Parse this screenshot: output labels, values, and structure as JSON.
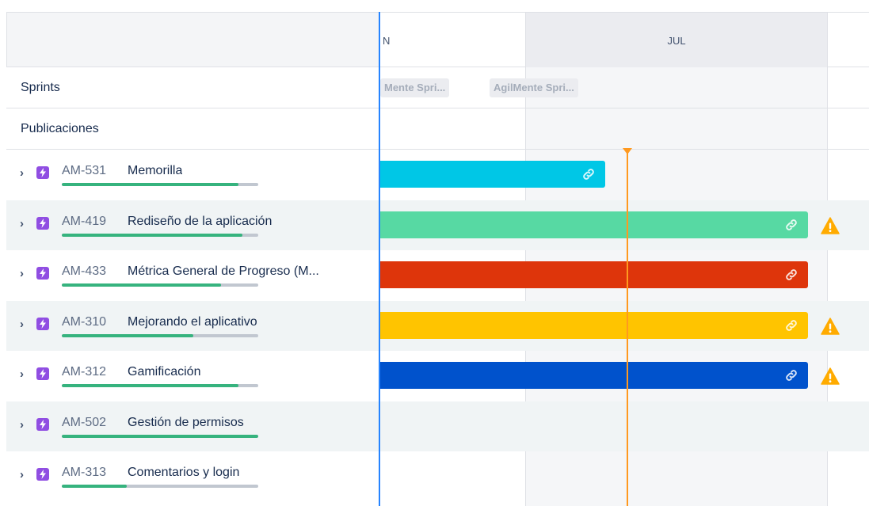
{
  "timeline": {
    "months": {
      "previous_partial": "N",
      "current": "JUL"
    },
    "sprints": [
      "Mente Spri...",
      "AgilMente Spri..."
    ]
  },
  "sections": {
    "sprints": "Sprints",
    "releases": "Publicaciones"
  },
  "issues": [
    {
      "key": "AM-531",
      "title": "Memorilla",
      "progress": 0.9,
      "bar_color": "#00c7e6",
      "bar_end_frac": 0.46,
      "warning": false
    },
    {
      "key": "AM-419",
      "title": "Rediseño de la aplicación",
      "progress": 0.92,
      "bar_color": "#57d9a3",
      "bar_end_frac": 0.875,
      "warning": true
    },
    {
      "key": "AM-433",
      "title": "Métrica General de Progreso (M...",
      "progress": 0.81,
      "bar_color": "#de350b",
      "bar_end_frac": 0.875,
      "warning": false
    },
    {
      "key": "AM-310",
      "title": "Mejorando el aplicativo",
      "progress": 0.67,
      "bar_color": "#ffc400",
      "bar_end_frac": 0.875,
      "warning": true
    },
    {
      "key": "AM-312",
      "title": "Gamificación",
      "progress": 0.9,
      "bar_color": "#0052cc",
      "bar_end_frac": 0.875,
      "warning": true
    },
    {
      "key": "AM-502",
      "title": "Gestión de permisos",
      "progress": 1.0,
      "bar_color": null,
      "bar_end_frac": 0,
      "warning": false
    },
    {
      "key": "AM-313",
      "title": "Comentarios y login",
      "progress": 0.33,
      "bar_color": null,
      "bar_end_frac": 0,
      "warning": false
    }
  ],
  "icons": {
    "expand": "chevron-right-icon",
    "epic": "epic-lightning-icon",
    "dependency": "link-icon",
    "warning": "warning-triangle-icon"
  },
  "colors": {
    "today_marker": "#ff991f",
    "epic": "#904ee2",
    "progress": "#36b37e",
    "scroll_edge": "#2684ff"
  }
}
